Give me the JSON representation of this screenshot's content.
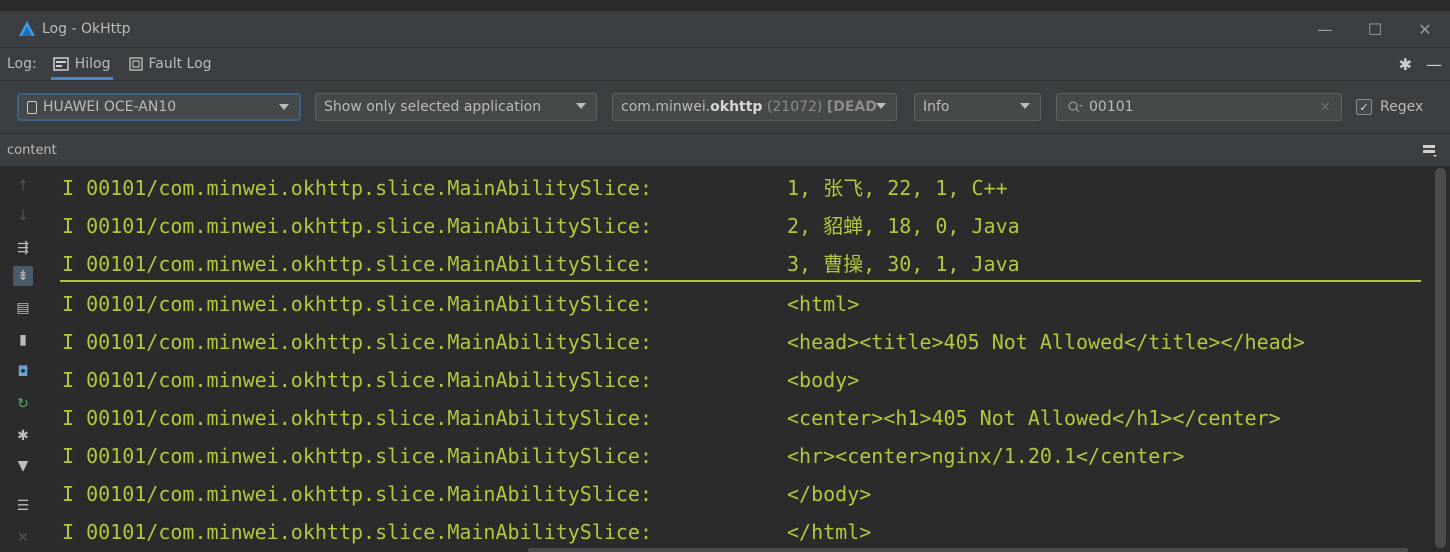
{
  "window": {
    "title": "Log - OkHttp",
    "controls": {
      "minimize": "—",
      "maximize": "☐",
      "close": "✕"
    }
  },
  "tabbar": {
    "log_label": "Log:",
    "tabs": [
      {
        "label": "Hilog",
        "icon": "hilog-icon",
        "active": true
      },
      {
        "label": "Fault Log",
        "icon": "fault-log-icon",
        "active": false
      }
    ]
  },
  "filters": {
    "device": "HUAWEI OCE-AN10",
    "app_filter": "Show only selected application",
    "package_prefix": "com.minwei.",
    "package_bold": "okhttp",
    "package_pid": " (21072) ",
    "package_state": "[DEAD",
    "level": "Info",
    "search_value": "00101",
    "search_clear": "×",
    "regex_label": "Regex",
    "regex_checked": true
  },
  "header": {
    "column": "content"
  },
  "log": {
    "color": "#b2c73d",
    "lines": [
      {
        "tag": "I 00101/com.minwei.okhttp.slice.MainAbilitySlice:",
        "msg": "1, 张飞, 22, 1, C++"
      },
      {
        "tag": "I 00101/com.minwei.okhttp.slice.MainAbilitySlice:",
        "msg": "2, 貂蝉, 18, 0, Java"
      },
      {
        "tag": "I 00101/com.minwei.okhttp.slice.MainAbilitySlice:",
        "msg": "3, 曹操, 30, 1, Java"
      },
      {
        "tag": "I 00101/com.minwei.okhttp.slice.MainAbilitySlice:",
        "msg": "<html>"
      },
      {
        "tag": "I 00101/com.minwei.okhttp.slice.MainAbilitySlice:",
        "msg": "<head><title>405 Not Allowed</title></head>"
      },
      {
        "tag": "I 00101/com.minwei.okhttp.slice.MainAbilitySlice:",
        "msg": "<body>"
      },
      {
        "tag": "I 00101/com.minwei.okhttp.slice.MainAbilitySlice:",
        "msg": "<center><h1>405 Not Allowed</h1></center>"
      },
      {
        "tag": "I 00101/com.minwei.okhttp.slice.MainAbilitySlice:",
        "msg": "<hr><center>nginx/1.20.1</center>"
      },
      {
        "tag": "I 00101/com.minwei.okhttp.slice.MainAbilitySlice:",
        "msg": "</body>"
      },
      {
        "tag": "I 00101/com.minwei.okhttp.slice.MainAbilitySlice:",
        "msg": "</html>"
      }
    ]
  }
}
